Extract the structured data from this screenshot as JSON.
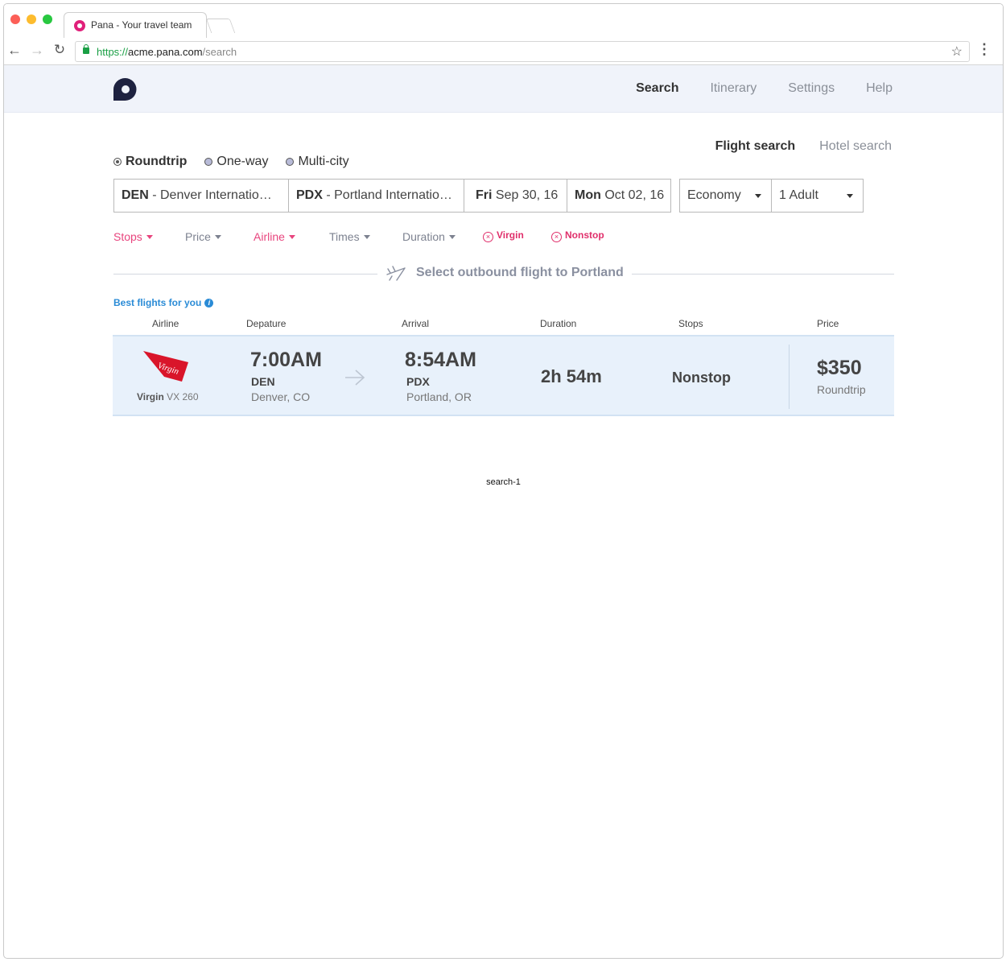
{
  "browser": {
    "tab_title": "Pana - Your travel team",
    "url_scheme": "https://",
    "url_host": "acme.pana.com",
    "url_path": "/search",
    "back_glyph": "←",
    "forward_glyph": "→",
    "reload_glyph": "↻",
    "star_glyph": "☆",
    "menu_glyph": "⋮"
  },
  "nav": {
    "items": [
      "Search",
      "Itinerary",
      "Settings",
      "Help"
    ],
    "active": "Search"
  },
  "search_tabs": {
    "flight": "Flight search",
    "hotel": "Hotel search"
  },
  "trip_type": {
    "options": [
      "Roundtrip",
      "One-way",
      "Multi-city"
    ],
    "selected": "Roundtrip"
  },
  "search_fields": {
    "origin_code": "DEN",
    "origin_name": " - Denver Internatio…",
    "dest_code": "PDX",
    "dest_name": " - Portland Internatio…",
    "depart_day": "Fri",
    "depart_date": " Sep 30, 16",
    "return_day": "Mon",
    "return_date": " Oct 02, 16",
    "cabin": "Economy",
    "passengers": "1 Adult"
  },
  "filters": {
    "stops": "Stops",
    "price": "Price",
    "airline": "Airline",
    "times": "Times",
    "duration": "Duration",
    "chip_virgin": "Virgin",
    "chip_nonstop": "Nonstop",
    "chip_close": "×"
  },
  "results": {
    "heading": "Select outbound flight to Portland",
    "best_label": "Best flights for you",
    "info_glyph": "i",
    "columns": {
      "airline": "Airline",
      "departure": "Depature",
      "arrival": "Arrival",
      "duration": "Duration",
      "stops": "Stops",
      "price": "Price"
    },
    "flights": [
      {
        "airline": "Virgin",
        "flight_no": " VX 260",
        "logo_text": "Virgin",
        "dep_time": "7:00AM",
        "dep_code": "DEN",
        "dep_city": "Denver, CO",
        "arr_time": "8:54AM",
        "arr_code": "PDX",
        "arr_city": "Portland, OR",
        "duration": "2h 54m",
        "stops": "Nonstop",
        "price": "$350",
        "price_type": "Roundtrip"
      }
    ]
  },
  "caption": "search-1",
  "colors": {
    "accent_pink": "#e8457e",
    "link_blue": "#2a8bd6",
    "row_bg": "#e8f1fb",
    "virgin_red": "#d9152a"
  }
}
